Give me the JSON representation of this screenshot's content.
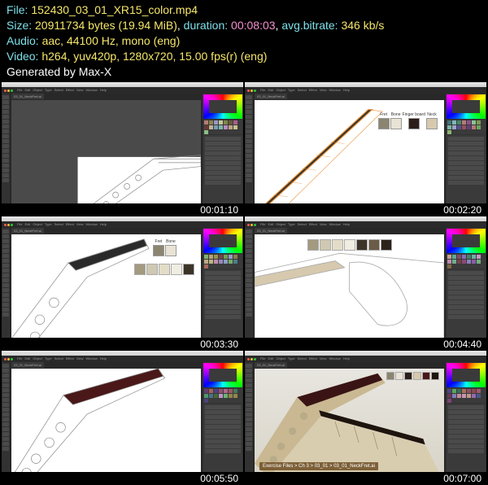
{
  "header": {
    "file_label": "File:",
    "file_value": "152430_03_01_XR15_color.mp4",
    "size_label": "Size:",
    "size_value": "20911734 bytes (19.94 MiB)",
    "duration_label": "duration:",
    "duration_value": "00:08:03",
    "bitrate_label": "avg.bitrate:",
    "bitrate_value": "346 kb/s",
    "audio_label": "Audio:",
    "audio_value": "aac, 44100 Hz, mono (eng)",
    "video_label": "Video:",
    "video_value": "h264, yuv420p, 1280x720, 15.00 fps(r) (eng)",
    "generated": "Generated by Max-X"
  },
  "menus": [
    "File",
    "Edit",
    "Object",
    "Type",
    "Select",
    "Effect",
    "View",
    "Window",
    "Help"
  ],
  "thumbs": [
    {
      "time": "00:01:10"
    },
    {
      "time": "00:02:20"
    },
    {
      "time": "00:03:30"
    },
    {
      "time": "00:04:40"
    },
    {
      "time": "00:05:50"
    },
    {
      "time": "00:07:00"
    }
  ],
  "callout_labels": {
    "fret": "Fret",
    "bone": "Bone",
    "finger": "Finger\nboard",
    "neck": "Neck"
  },
  "swatch_colors": {
    "fret": "#8b8570",
    "bone": "#e8e3d4",
    "finger": "#2b1e18",
    "neck": "#d6c9ae",
    "row": [
      "#a39a80",
      "#cfc8b2",
      "#e3ddc8",
      "#f0ede2",
      "#3d3428",
      "#6b5c48",
      "#2c221a"
    ]
  },
  "path_hint": "Exercise Files > Ch 3 > 03_01 > 03_01_NeckFret.ai",
  "canvas_file": "03_01_NeckFret.ai"
}
